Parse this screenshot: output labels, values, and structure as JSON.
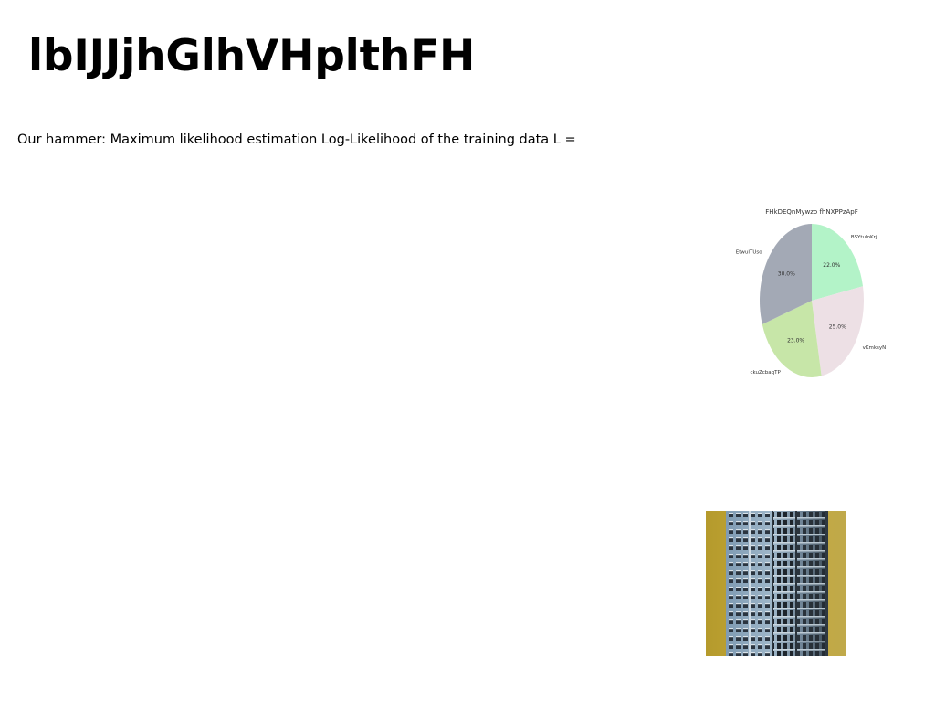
{
  "slide": {
    "title": "lbIJJjhGlhVHplthFH",
    "body_text": "Our hammer: Maximum likelihood estimation Log-Likelihood of the training data L ="
  },
  "chart_data": {
    "type": "pie",
    "title": "FHkDEQnMywzo fhNXPPzApF",
    "slices": [
      {
        "label": "BSYtuloKrj",
        "value": 22.0,
        "pct_label": "22.0%",
        "color": "#b3f3c8"
      },
      {
        "label": "vKmksyN",
        "value": 25.0,
        "pct_label": "25.0%",
        "color": "#ede0e5"
      },
      {
        "label": "ckuZcbaqTP",
        "value": 23.0,
        "pct_label": "23.0%",
        "color": "#c7e6a8"
      },
      {
        "label": "EtwuITUso",
        "value": 30.0,
        "pct_label": "30.0%",
        "color": "#a3a9b5"
      }
    ],
    "start_angle": "12 o'clock",
    "direction": "clockwise"
  },
  "photo": {
    "subject": "tall-apartment-building"
  }
}
